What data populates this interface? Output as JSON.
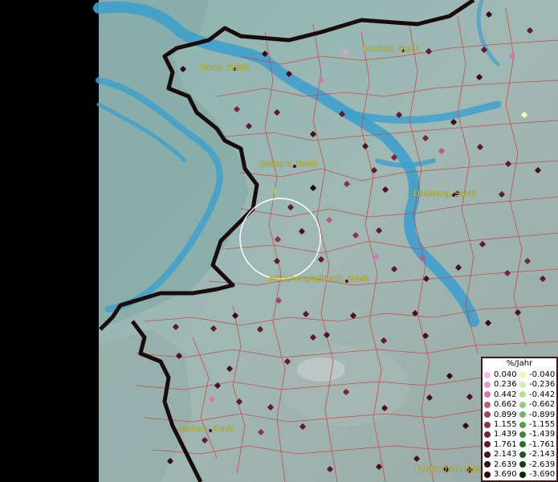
{
  "legend": {
    "title": "%/Jahr",
    "positive": [
      {
        "label": "0.040",
        "color": "#f5b8e8"
      },
      {
        "label": "0.236",
        "color": "#e69ac8"
      },
      {
        "label": "0.442",
        "color": "#d07aa8"
      },
      {
        "label": "0.662",
        "color": "#b85a84"
      },
      {
        "label": "0.899",
        "color": "#a04466"
      },
      {
        "label": "1.155",
        "color": "#8a3350"
      },
      {
        "label": "1.439",
        "color": "#74263e"
      },
      {
        "label": "1.761",
        "color": "#5e1a2e"
      },
      {
        "label": "2.143",
        "color": "#4a1020"
      },
      {
        "label": "2.639",
        "color": "#380a16"
      },
      {
        "label": "3.690",
        "color": "#22040a"
      }
    ],
    "negative": [
      {
        "label": "-0.040",
        "color": "#f2f5b0"
      },
      {
        "label": "-0.236",
        "color": "#d8ecae"
      },
      {
        "label": "-0.442",
        "color": "#b6de96"
      },
      {
        "label": "-0.662",
        "color": "#94cc7c"
      },
      {
        "label": "-0.899",
        "color": "#72b862"
      },
      {
        "label": "-1.155",
        "color": "#54a04a"
      },
      {
        "label": "-1.439",
        "color": "#3e8838"
      },
      {
        "label": "-1.761",
        "color": "#2c6e2a"
      },
      {
        "label": "-2.143",
        "color": "#1e561e"
      },
      {
        "label": "-2.639",
        "color": "#123e12"
      },
      {
        "label": "-3.690",
        "color": "#062806"
      }
    ]
  },
  "cities": [
    {
      "name": "Kleve, Stadt"
    },
    {
      "name": "Bocholt, Stadt"
    },
    {
      "name": "Geldern, Stadt"
    },
    {
      "name": "Duisburg, Stadt"
    },
    {
      "name": "Mönchengladbach, Stadt"
    },
    {
      "name": "Aachen, Stadt"
    },
    {
      "name": "Euskirchen, Stadt"
    }
  ],
  "colors": {
    "background": "#000000",
    "terrain": "#8fb0ad",
    "river": "#3fa0cc",
    "district_border": "#d23a3a",
    "country_border": "#1a0c0c",
    "city_label": "#d9d233",
    "selection_circle": "#ffffff"
  }
}
